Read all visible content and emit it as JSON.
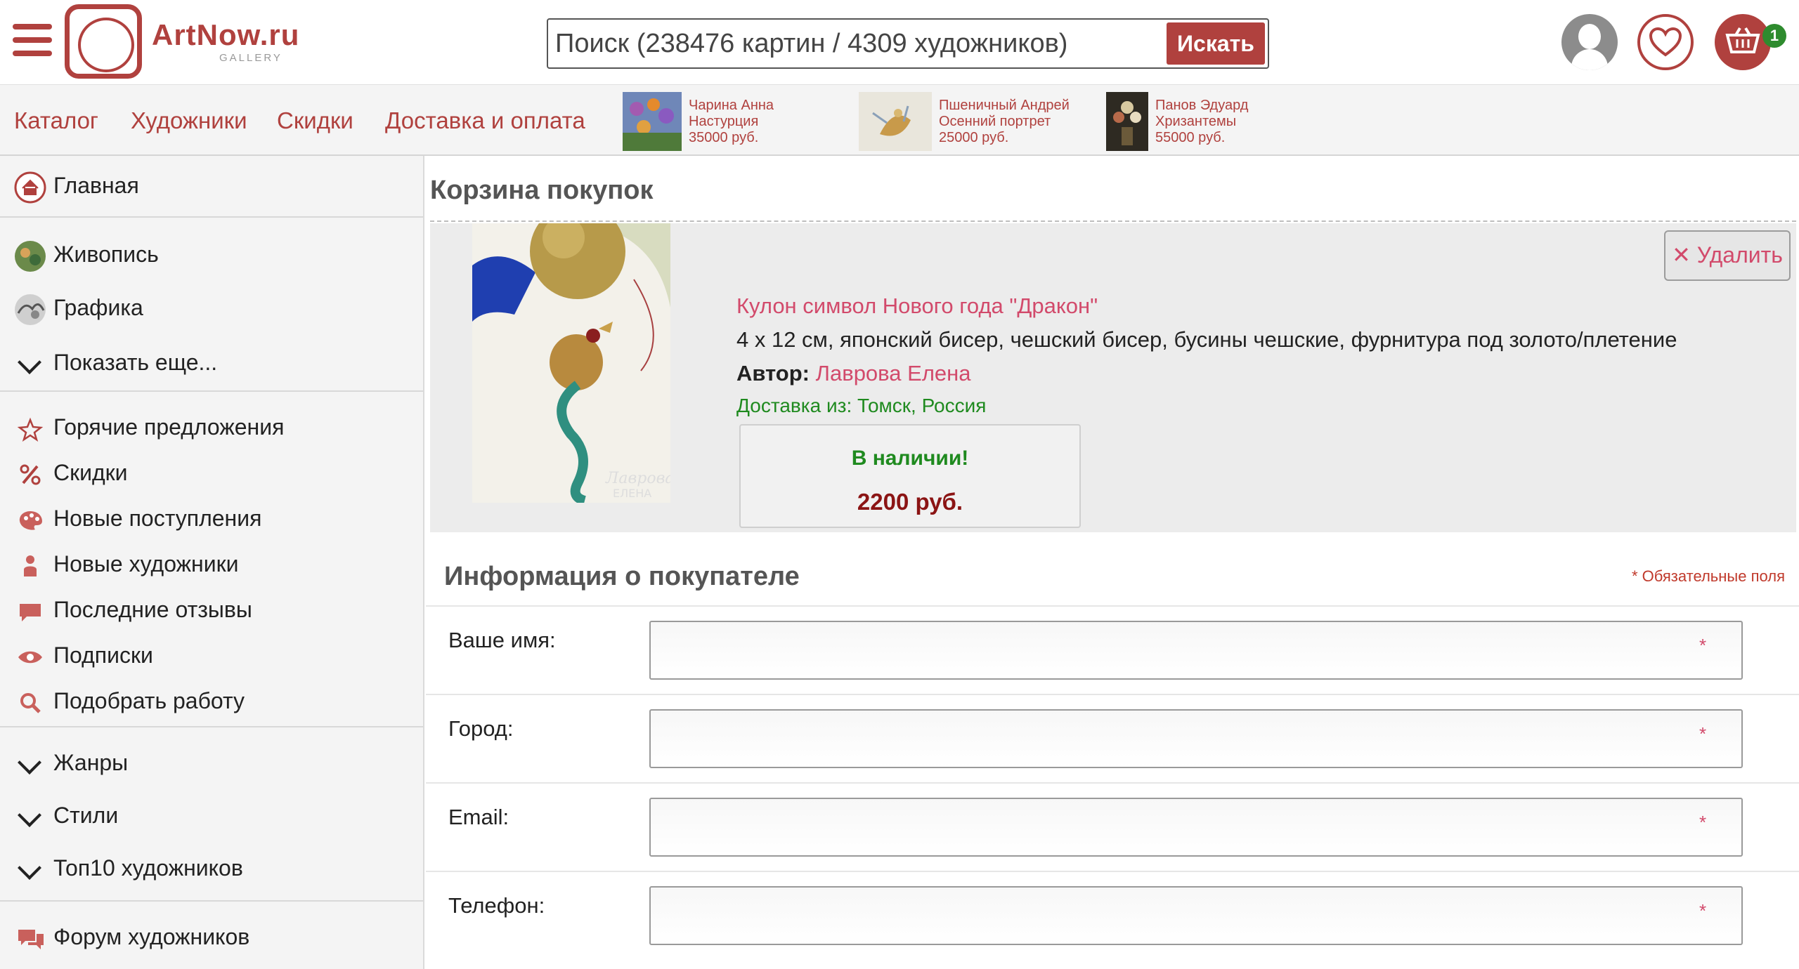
{
  "header": {
    "logo": {
      "text": "ArtNow.ru",
      "sub": "GALLERY"
    },
    "search": {
      "placeholder": "Поиск (238476 картин / 4309 художников)",
      "button": "Искать"
    },
    "cart_count": "1",
    "icons": {
      "menu": "hamburger-icon",
      "user": "user-icon",
      "favorites": "heart-icon",
      "cart": "basket-icon"
    }
  },
  "nav": {
    "links": [
      "Каталог",
      "Художники",
      "Скидки",
      "Доставка и оплата"
    ],
    "promos": [
      {
        "artist": "Чарина Анна",
        "title": "Настурция",
        "price": "35000 руб."
      },
      {
        "artist": "Пшеничный Андрей",
        "title": "Осенний портрет",
        "price": "25000 руб."
      },
      {
        "artist": "Панов Эдуард",
        "title": "Хризантемы",
        "price": "55000 руб."
      }
    ]
  },
  "sidebar": {
    "home": "Главная",
    "categories": [
      "Живопись",
      "Графика"
    ],
    "show_more": "Показать еще...",
    "links": [
      "Горячие предложения",
      "Скидки",
      "Новые поступления",
      "Новые художники",
      "Последние отзывы",
      "Подписки",
      "Подобрать работу"
    ],
    "groups": [
      "Жанры",
      "Стили",
      "Топ10 художников"
    ],
    "forum": "Форум художников"
  },
  "main": {
    "title": "Корзина покупок",
    "item": {
      "delete": "Удалить",
      "title": "Кулон символ Нового года \"Дракон\"",
      "description": "4 x 12 см, японский бисер, чешский бисер, бусины чешские, фурнитура под золото/плетение",
      "author_label": "Автор:",
      "author": "Лаврова Елена",
      "shipping": "Доставка из: Томск, Россия",
      "availability": "В наличии!",
      "price": "2200 руб."
    },
    "buyer": {
      "title": "Информация о покупателе",
      "required_note": "* Обязательные поля",
      "fields": [
        {
          "label": "Ваше имя:",
          "value": ""
        },
        {
          "label": "Город:",
          "value": ""
        },
        {
          "label": "Email:",
          "value": ""
        },
        {
          "label": "Телефон:",
          "value": ""
        }
      ],
      "required_mark": "*"
    }
  },
  "colors": {
    "brand": "#b0413e",
    "link": "#d24a6b",
    "ok": "#1f8a1f",
    "price": "#8b1414"
  }
}
